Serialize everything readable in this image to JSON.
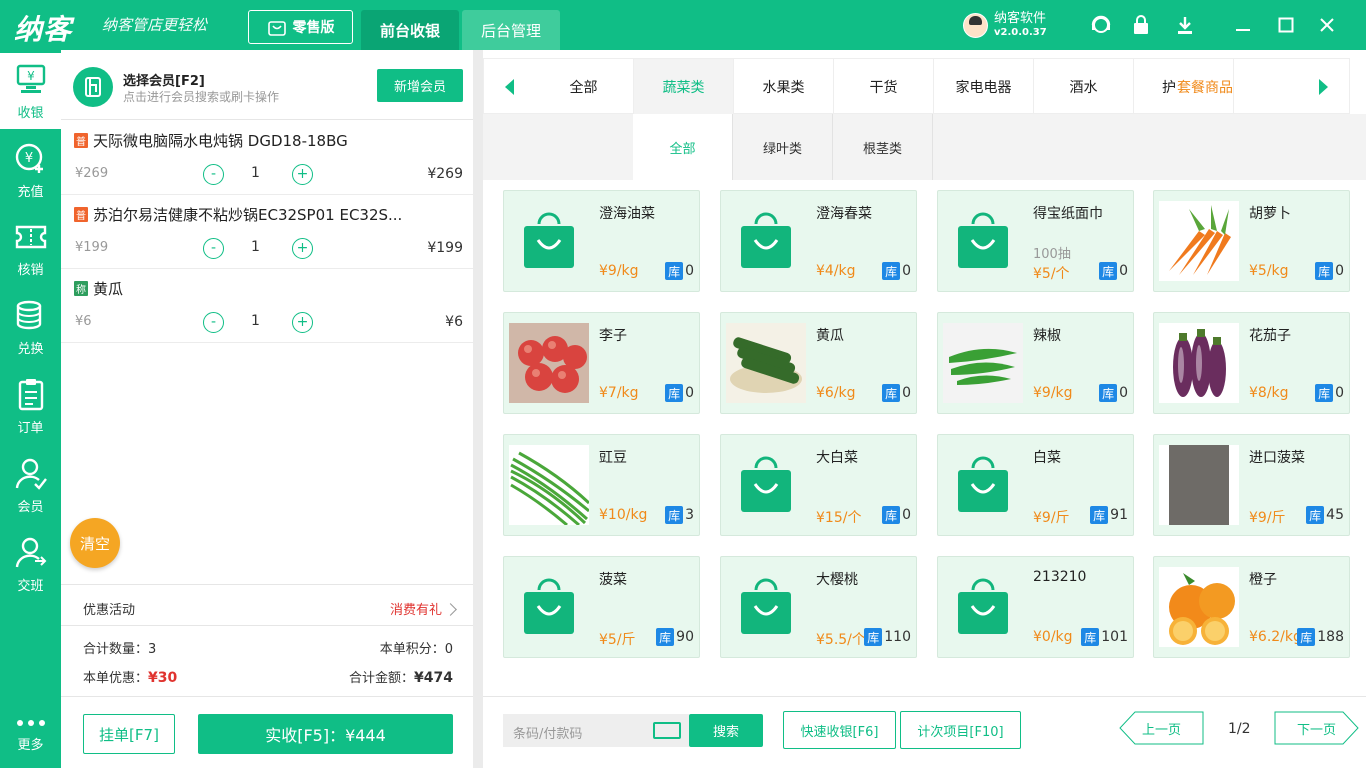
{
  "app": {
    "logo": "纳客",
    "slogan": "纳客管店更轻松",
    "edition": "零售版",
    "nav_tabs": [
      "前台收银",
      "后台管理"
    ],
    "user_name": "纳客软件",
    "version": "v2.0.0.37"
  },
  "sidebar": {
    "items": [
      "收银",
      "充值",
      "核销",
      "兑换",
      "订单",
      "会员",
      "交班"
    ],
    "more": "更多"
  },
  "member": {
    "title": "选择会员[F2]",
    "subtitle": "点击进行会员搜索或刷卡操作",
    "add_button": "新增会员"
  },
  "cart": {
    "items": [
      {
        "tag": "普",
        "name": "天际微电脑隔水电炖锅 DGD18-18BG",
        "price": "¥269",
        "qty": "1",
        "total": "¥269"
      },
      {
        "tag": "普",
        "name": "苏泊尔易洁健康不粘炒锅EC32SP01 EC32S...",
        "price": "¥199",
        "qty": "1",
        "total": "¥199"
      },
      {
        "tag": "称",
        "name": "黄瓜",
        "price": "¥6",
        "qty": "1",
        "total": "¥6"
      }
    ],
    "minus": "-",
    "plus": "+",
    "clear": "清空"
  },
  "promotion": {
    "label": "优惠活动",
    "value": "消费有礼"
  },
  "summary": {
    "qty_label": "合计数量：",
    "qty_value": "3",
    "points_label": "本单积分：",
    "points_value": "0",
    "discount_label": "本单优惠：",
    "discount_value": "¥30",
    "total_label": "合计金额：",
    "total_value": "¥474"
  },
  "actions": {
    "hold": "挂单[F7]",
    "pay": "实收[F5]：¥444"
  },
  "categories": {
    "tabs": [
      "全部",
      "蔬菜类",
      "水果类",
      "干货",
      "家电电器",
      "酒水",
      "护肤品"
    ],
    "extra": "套餐商品",
    "active": 1,
    "sub_tabs": [
      "全部",
      "绿叶类",
      "根茎类"
    ],
    "sub_active": 0
  },
  "products": [
    {
      "name": "澄海油菜",
      "desc": "",
      "price": "¥9/kg",
      "stock": "0",
      "img": "bag"
    },
    {
      "name": "澄海春菜",
      "desc": "",
      "price": "¥4/kg",
      "stock": "0",
      "img": "bag"
    },
    {
      "name": "得宝纸面巾",
      "desc": "100抽",
      "price": "¥5/个",
      "stock": "0",
      "img": "bag"
    },
    {
      "name": "胡萝卜",
      "desc": "",
      "price": "¥5/kg",
      "stock": "0",
      "img": "carrot"
    },
    {
      "name": "李子",
      "desc": "",
      "price": "¥7/kg",
      "stock": "0",
      "img": "plum"
    },
    {
      "name": "黄瓜",
      "desc": "",
      "price": "¥6/kg",
      "stock": "0",
      "img": "cucumber"
    },
    {
      "name": "辣椒",
      "desc": "",
      "price": "¥9/kg",
      "stock": "0",
      "img": "pepper"
    },
    {
      "name": "花茄子",
      "desc": "",
      "price": "¥8/kg",
      "stock": "0",
      "img": "eggplant"
    },
    {
      "name": "豇豆",
      "desc": "",
      "price": "¥10/kg",
      "stock": "3",
      "img": "beans"
    },
    {
      "name": "大白菜",
      "desc": "",
      "price": "¥15/个",
      "stock": "0",
      "img": "bag"
    },
    {
      "name": "白菜",
      "desc": "",
      "price": "¥9/斤",
      "stock": "91",
      "img": "bag"
    },
    {
      "name": "进口菠菜",
      "desc": "",
      "price": "¥9/斤",
      "stock": "45",
      "img": "gray"
    },
    {
      "name": "菠菜",
      "desc": "",
      "price": "¥5/斤",
      "stock": "90",
      "img": "bag"
    },
    {
      "name": "大樱桃",
      "desc": "",
      "price": "¥5.5/个",
      "stock": "110",
      "img": "bag"
    },
    {
      "name": "213210",
      "desc": "",
      "price": "¥0/kg",
      "stock": "101",
      "img": "bag"
    },
    {
      "name": "橙子",
      "desc": "",
      "price": "¥6.2/kg",
      "stock": "188",
      "img": "orange"
    }
  ],
  "stock_label": "库",
  "footer": {
    "search_placeholder": "条码/付款码",
    "search_button": "搜索",
    "quick_button": "快速收银[F6]",
    "count_button": "计次项目[F10]",
    "prev": "上一页",
    "page": "1/2",
    "next": "下一页"
  },
  "colors": {
    "brand": "#10be86",
    "price": "#f08a1a",
    "discount": "#e0332f",
    "stock_badge": "#1e88e5",
    "clear": "#f5a623"
  }
}
